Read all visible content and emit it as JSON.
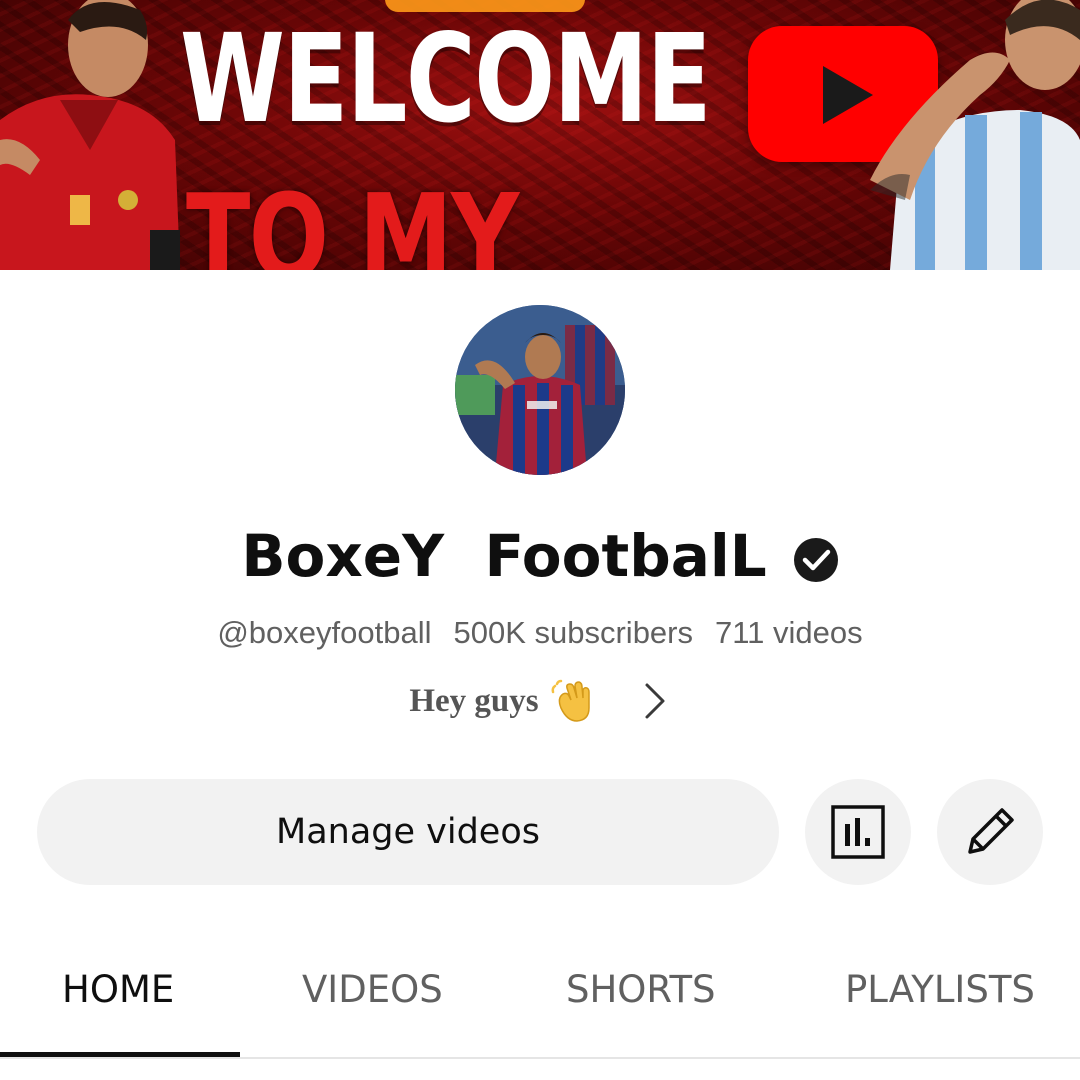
{
  "banner": {
    "line1": "WELCOME",
    "line2": "TO MY CHANNEL",
    "icon": "youtube-play-icon",
    "colors": {
      "background": "#7a0808",
      "line1": "#ffffff",
      "line2": "#e31b1b",
      "logo": "#ff0000"
    }
  },
  "channel": {
    "name": "BoxeY  FootbalL",
    "verified_icon": "verified-check-icon",
    "handle": "@boxeyfootball",
    "subscribers": "500K subscribers",
    "videos": "711 videos",
    "description": "Hey guys",
    "description_emoji": "👋",
    "more_icon": "chevron-right-icon"
  },
  "actions": {
    "manage_label": "Manage videos",
    "analytics_icon": "analytics-icon",
    "edit_icon": "pencil-icon"
  },
  "tabs": [
    {
      "label": "HOME",
      "active": true
    },
    {
      "label": "VIDEOS",
      "active": false
    },
    {
      "label": "SHORTS",
      "active": false
    },
    {
      "label": "PLAYLISTS",
      "active": false
    }
  ],
  "colors": {
    "text_primary": "#0f0f0f",
    "text_secondary": "#606060",
    "button_bg": "#f2f2f2",
    "divider": "#e5e5e5"
  }
}
